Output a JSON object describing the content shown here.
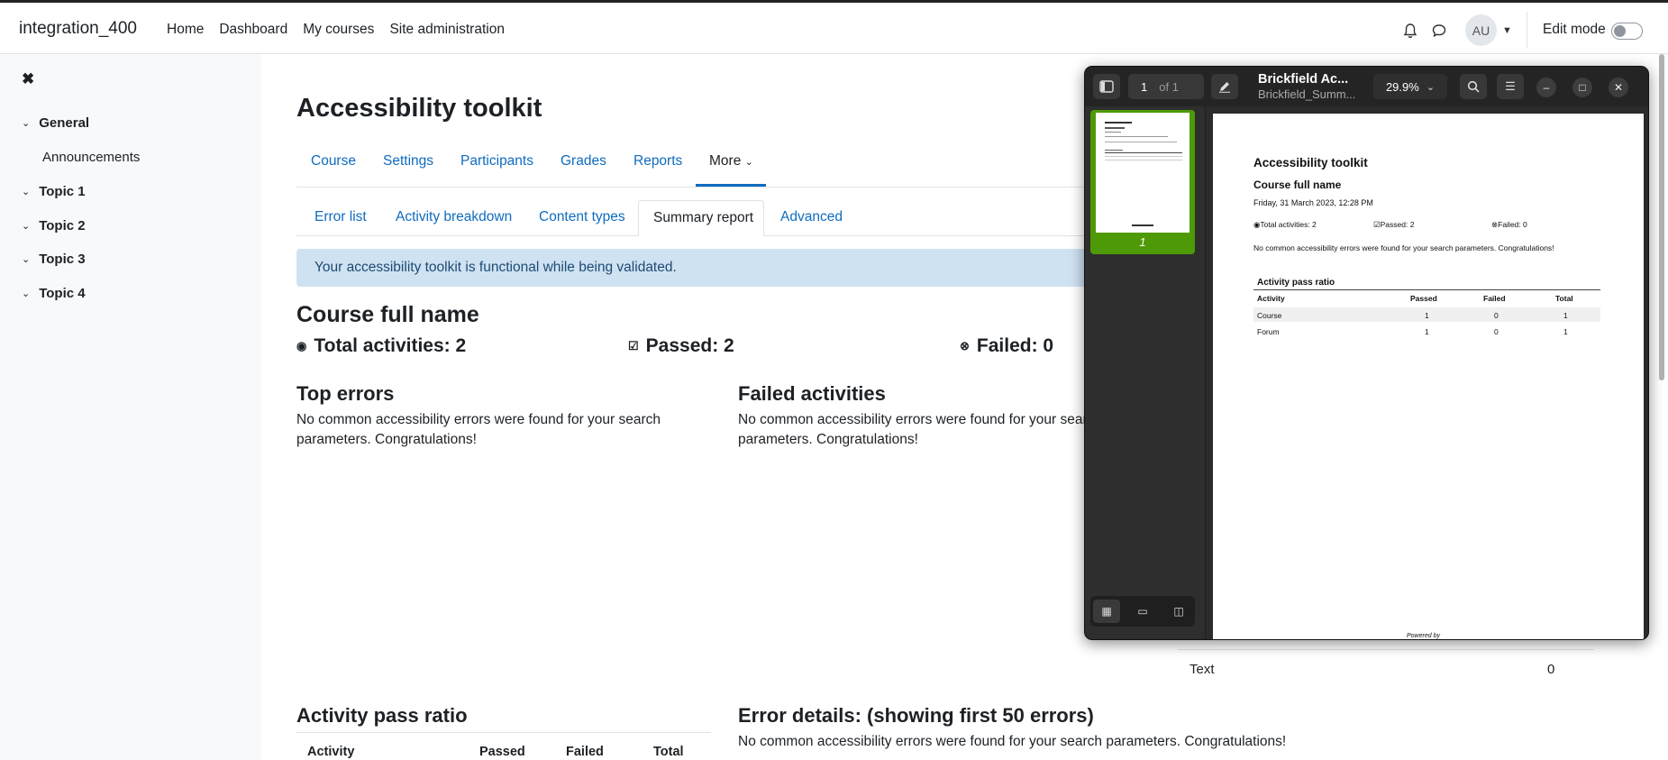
{
  "topbar": {
    "site_name": "integration_400",
    "nav": [
      "Home",
      "Dashboard",
      "My courses",
      "Site administration"
    ],
    "avatar_initials": "AU",
    "edit_mode_label": "Edit mode",
    "edit_mode_on": false
  },
  "drawer": {
    "sections": [
      {
        "label": "General",
        "children": [
          "Announcements"
        ]
      },
      {
        "label": "Topic 1"
      },
      {
        "label": "Topic 2"
      },
      {
        "label": "Topic 3"
      },
      {
        "label": "Topic 4"
      }
    ]
  },
  "main": {
    "title": "Accessibility toolkit",
    "secondary_nav": [
      "Course",
      "Settings",
      "Participants",
      "Grades",
      "Reports",
      "More"
    ],
    "secondary_nav_active": "More",
    "tabs": [
      "Error list",
      "Activity breakdown",
      "Content types",
      "Summary report",
      "Advanced"
    ],
    "tabs_active": "Summary report",
    "alert": "Your accessibility toolkit is functional while being validated.",
    "course_name": "Course full name",
    "stats": {
      "total": "Total activities: 2",
      "passed": "Passed: 2",
      "failed": "Failed: 0"
    },
    "top_errors": {
      "heading": "Top errors",
      "text": "No common accessibility errors were found for your search parameters. Congratulations!"
    },
    "failed_activities": {
      "heading": "Failed activities",
      "text": "No common accessibility errors were found for your search parameters. Congratulations!"
    },
    "content_row": {
      "label": "Text",
      "value": "0"
    },
    "activity_pass_ratio": {
      "heading": "Activity pass ratio",
      "columns": [
        "Activity",
        "Passed",
        "Failed",
        "Total"
      ]
    },
    "error_details": {
      "heading": "Error details: (showing first 50 errors)",
      "text": "No common accessibility errors were found for your search parameters. Congratulations!"
    }
  },
  "pdf_viewer": {
    "page_input": "1",
    "page_total": "of 1",
    "title": "Brickfield Ac...",
    "subtitle": "Brickfield_Summ...",
    "zoom": "29.9%",
    "thumb_page_label": "1",
    "document": {
      "title": "Accessibility toolkit",
      "course": "Course full name",
      "date": "Friday, 31 March 2023, 12:28 PM",
      "stats": [
        "Total activities: 2",
        "Passed: 2",
        "Failed: 0"
      ],
      "message": "No common accessibility errors were found for your search parameters. Congratulations!",
      "table_title": "Activity pass ratio",
      "columns": [
        "Activity",
        "Passed",
        "Failed",
        "Total"
      ],
      "rows": [
        [
          "Course",
          "1",
          "0",
          "1"
        ],
        [
          "Forum",
          "1",
          "0",
          "1"
        ]
      ],
      "footer": "Powered by"
    }
  }
}
